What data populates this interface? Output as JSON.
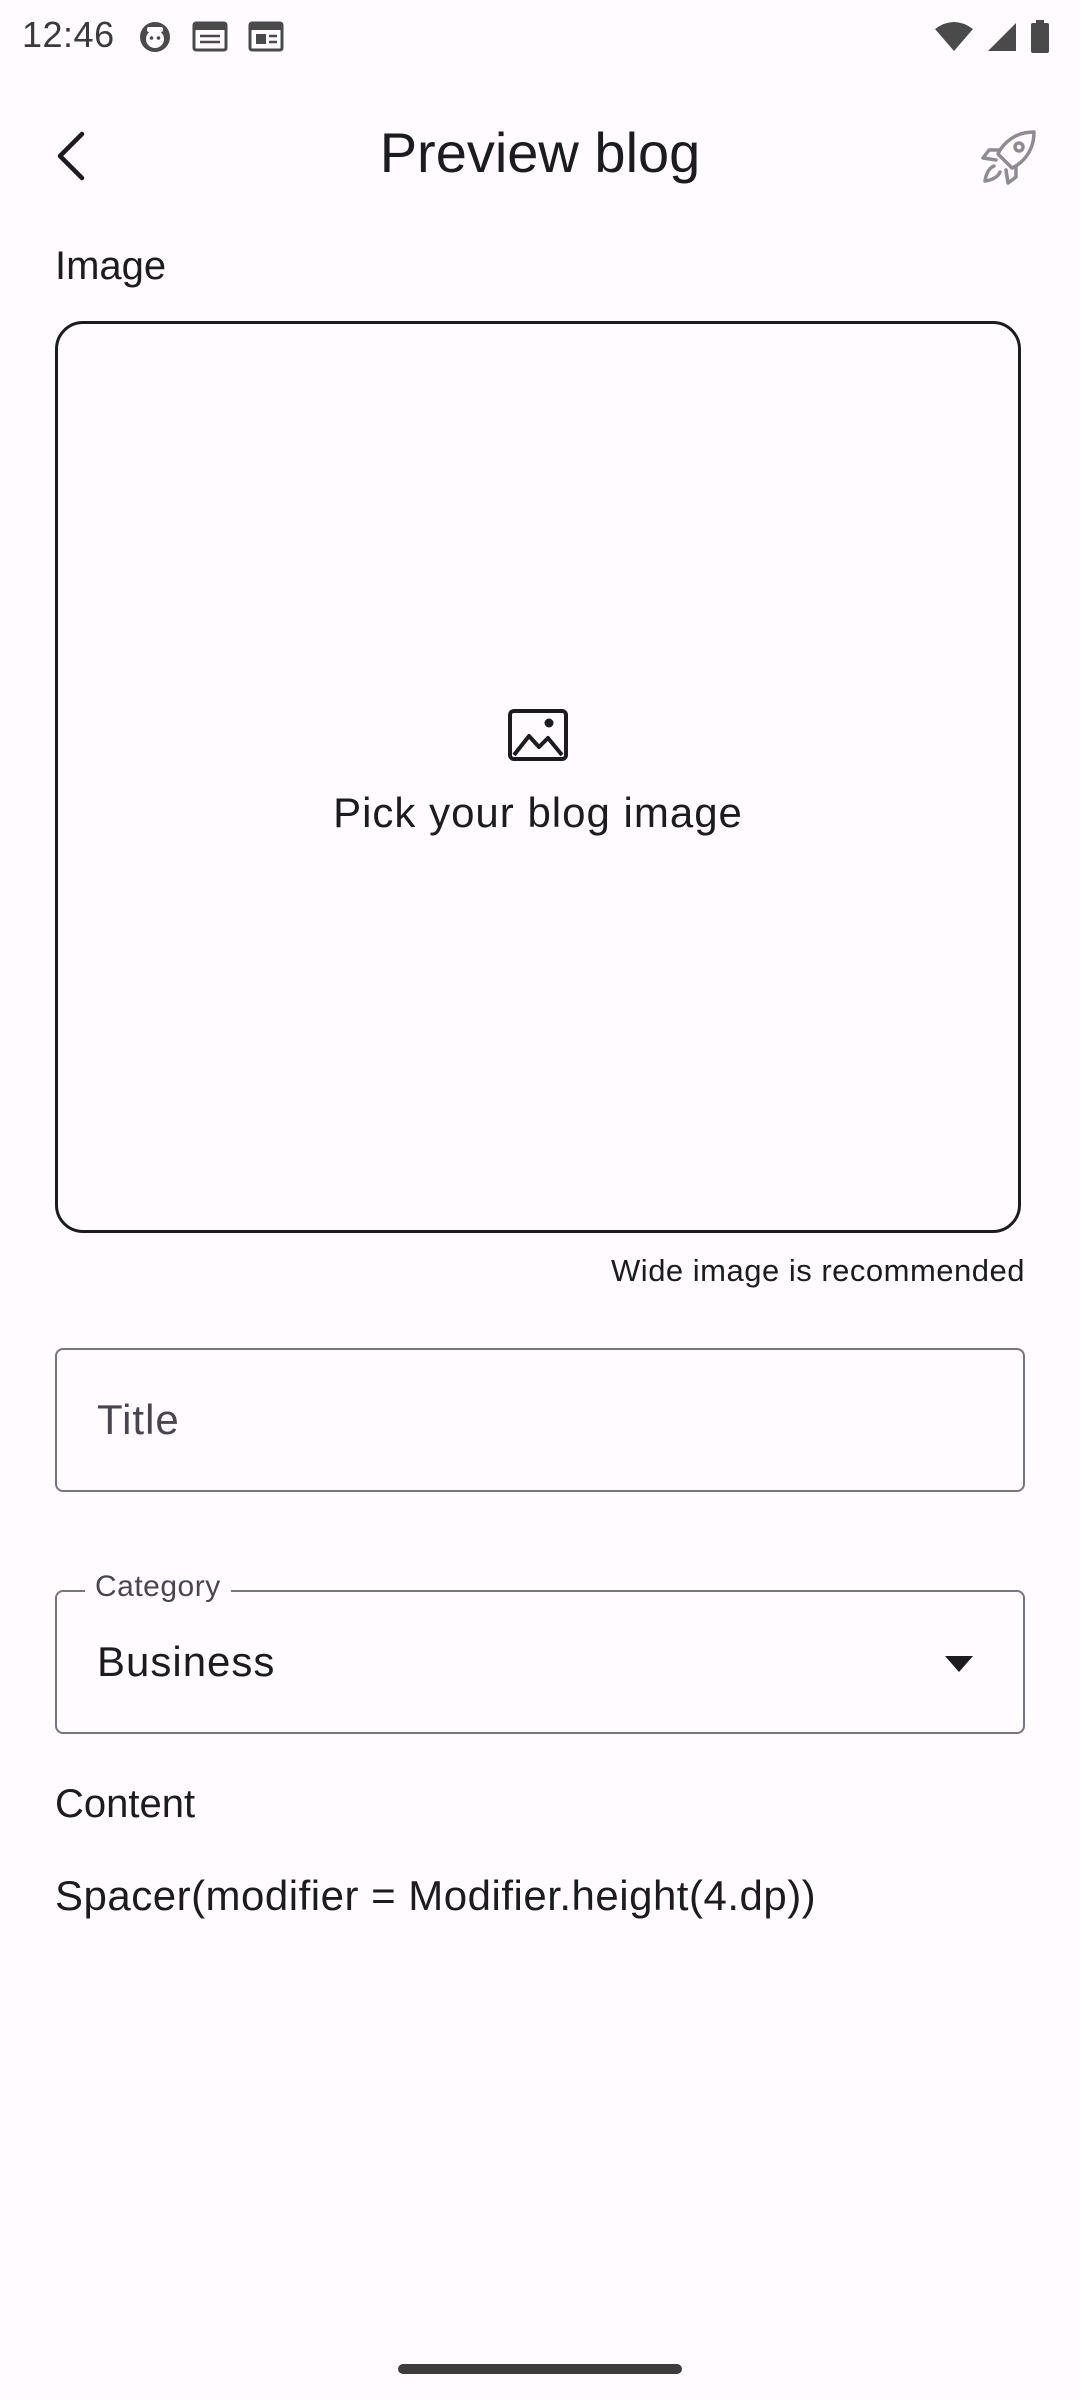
{
  "status_bar": {
    "time": "12:46",
    "left_icons": [
      "face-notification-icon",
      "calendar-notification-icon",
      "calendar-notification-icon"
    ],
    "right_icons": [
      "wifi-icon",
      "cellular-signal-icon",
      "battery-icon"
    ]
  },
  "app_bar": {
    "title": "Preview blog",
    "back_icon": "chevron-left-icon",
    "publish_icon": "rocket-icon"
  },
  "image_section": {
    "label": "Image",
    "picker_icon": "image-icon",
    "picker_text": "Pick your blog image",
    "hint": "Wide image is recommended"
  },
  "title_field": {
    "placeholder": "Title",
    "value": ""
  },
  "category_field": {
    "label": "Category",
    "value": "Business",
    "dropdown_icon": "dropdown-arrow-icon"
  },
  "content_section": {
    "label": "Content",
    "body": "Spacer(modifier = Modifier.height(4.dp))"
  },
  "colors": {
    "background": "#FFFBFE",
    "text": "#1C1B1F",
    "outline": "#79747E"
  }
}
